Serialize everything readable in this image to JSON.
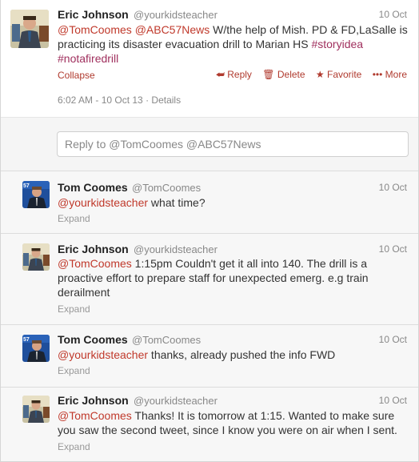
{
  "tweets": [
    {
      "name": "Eric Johnson",
      "handle": "@yourkidsteacher",
      "time": "10 Oct",
      "text_parts": [
        "@TomCoomes",
        "@ABC57News",
        " W/the help of Mish. PD & FD,LaSalle is practicing its disaster evacuation drill to Marian HS ",
        "#storyidea",
        "#notafiredrill"
      ],
      "collapse_label": "Collapse",
      "reply_label": "Reply",
      "delete_label": "Delete",
      "favorite_label": "Favorite",
      "more_label": "More",
      "timestamp": "6:02 AM - 10 Oct 13",
      "details_label": "Details"
    },
    {
      "name": "Tom Coomes",
      "handle": "@TomCoomes",
      "time": "10 Oct",
      "text_parts": [
        "@yourkidsteacher",
        " what time?"
      ],
      "expand_label": "Expand"
    },
    {
      "name": "Eric Johnson",
      "handle": "@yourkidsteacher",
      "time": "10 Oct",
      "text_parts": [
        "@TomCoomes",
        " 1:15pm Couldn't get it all into 140. The drill is a proactive effort to prepare staff for unexpected emerg. e.g train derailment"
      ],
      "expand_label": "Expand"
    },
    {
      "name": "Tom Coomes",
      "handle": "@TomCoomes",
      "time": "10 Oct",
      "text_parts": [
        "@yourkidsteacher",
        " thanks, already pushed the info FWD"
      ],
      "expand_label": "Expand"
    },
    {
      "name": "Eric Johnson",
      "handle": "@yourkidsteacher",
      "time": "10 Oct",
      "text_parts": [
        "@TomCoomes",
        " Thanks! It is tomorrow at 1:15. Wanted to make sure you saw the second tweet, since I know you were on air when I sent."
      ],
      "expand_label": "Expand"
    }
  ],
  "reply_box": {
    "text": "Reply to @TomCoomes @ABC57News"
  },
  "avatar_badge": "57",
  "colors": {
    "link": "#b03a2e",
    "hashtag": "#a0305e",
    "muted": "#888888"
  },
  "icons": {
    "reply": "reply-arrow-icon",
    "delete": "trash-icon",
    "favorite": "star-icon",
    "more": "more-dots-icon"
  }
}
